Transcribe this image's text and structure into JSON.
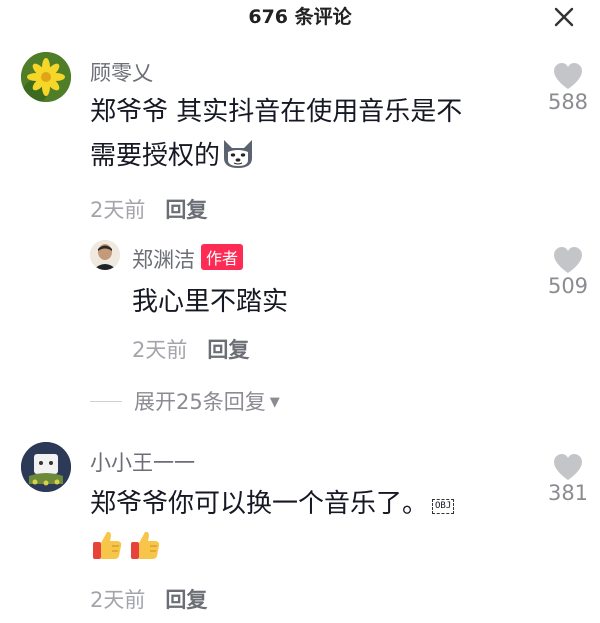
{
  "header": {
    "title": "676 条评论"
  },
  "comments": [
    {
      "username": "顾零乂",
      "text_line1": "郑爷爷 其实抖音在使用音乐是不",
      "text_line2": "需要授权的",
      "time": "2天前",
      "reply_label": "回复",
      "likes": "588",
      "emoji": "husky-dog-emoji",
      "replies": [
        {
          "username": "郑渊洁",
          "badge": "作者",
          "text": "我心里不踏实",
          "time": "2天前",
          "reply_label": "回复",
          "likes": "509"
        }
      ],
      "expand_label": "展开25条回复"
    },
    {
      "username": "小小王一一",
      "text_line1": "郑爷爷你可以换一个音乐了。",
      "obj_label": "OBJ",
      "time": "2天前",
      "reply_label": "回复",
      "likes": "381",
      "emoji": "thumbs-up-emoji"
    }
  ],
  "colors": {
    "accent": "#fe2c55",
    "heart": "#c4c5c9",
    "muted": "#a3a5ab"
  }
}
